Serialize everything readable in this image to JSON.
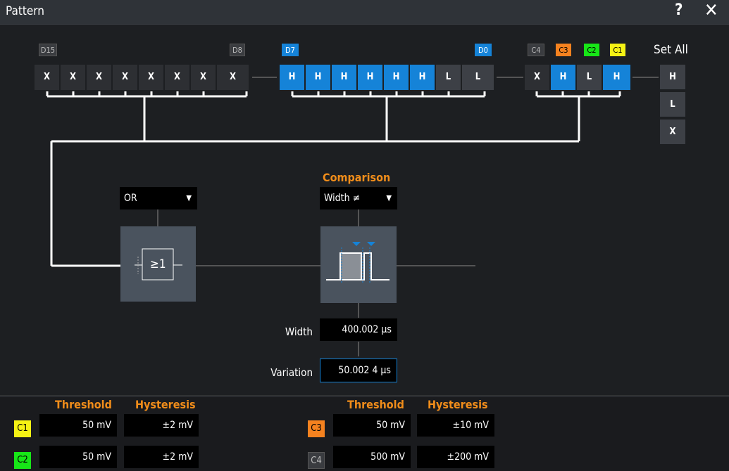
{
  "window": {
    "title": "Pattern",
    "help_icon": "?",
    "close_icon": "✕"
  },
  "digital_group_high": {
    "label_left": "D15",
    "label_right": "D8",
    "bits": [
      "X",
      "X",
      "X",
      "X",
      "X",
      "X",
      "X",
      "X"
    ]
  },
  "digital_group_low": {
    "label_left": "D7",
    "label_right": "D0",
    "bits": [
      "H",
      "H",
      "H",
      "H",
      "H",
      "H",
      "L",
      "L"
    ]
  },
  "analog_group": {
    "labels": [
      "C4",
      "C3",
      "C2",
      "C1"
    ],
    "bits": [
      "X",
      "H",
      "L",
      "H"
    ]
  },
  "set_all": {
    "title": "Set All",
    "buttons": [
      "H",
      "L",
      "X"
    ]
  },
  "logic": {
    "operator": "OR",
    "symbol": "≥1"
  },
  "comparison": {
    "title": "Comparison",
    "mode": "Width ≠",
    "width_label": "Width",
    "width_value": "400.002 µs",
    "variation_label": "Variation",
    "variation_value": "50.002 4 µs"
  },
  "thresholds": {
    "header_threshold": "Threshold",
    "header_hysteresis": "Hysteresis",
    "left": [
      {
        "channel": "C1",
        "threshold": "50 mV",
        "hysteresis": "±2 mV"
      },
      {
        "channel": "C2",
        "threshold": "50 mV",
        "hysteresis": "±2 mV"
      }
    ],
    "right": [
      {
        "channel": "C3",
        "threshold": "50 mV",
        "hysteresis": "±10 mV"
      },
      {
        "channel": "C4",
        "threshold": "500 mV",
        "hysteresis": "±200 mV"
      }
    ]
  },
  "colors": {
    "C1": "#f5f214",
    "C2": "#17e617",
    "C3": "#f5821f",
    "C4": "#3a3c40",
    "digital_active": "#1583d8",
    "accent": "#f18d1a"
  }
}
